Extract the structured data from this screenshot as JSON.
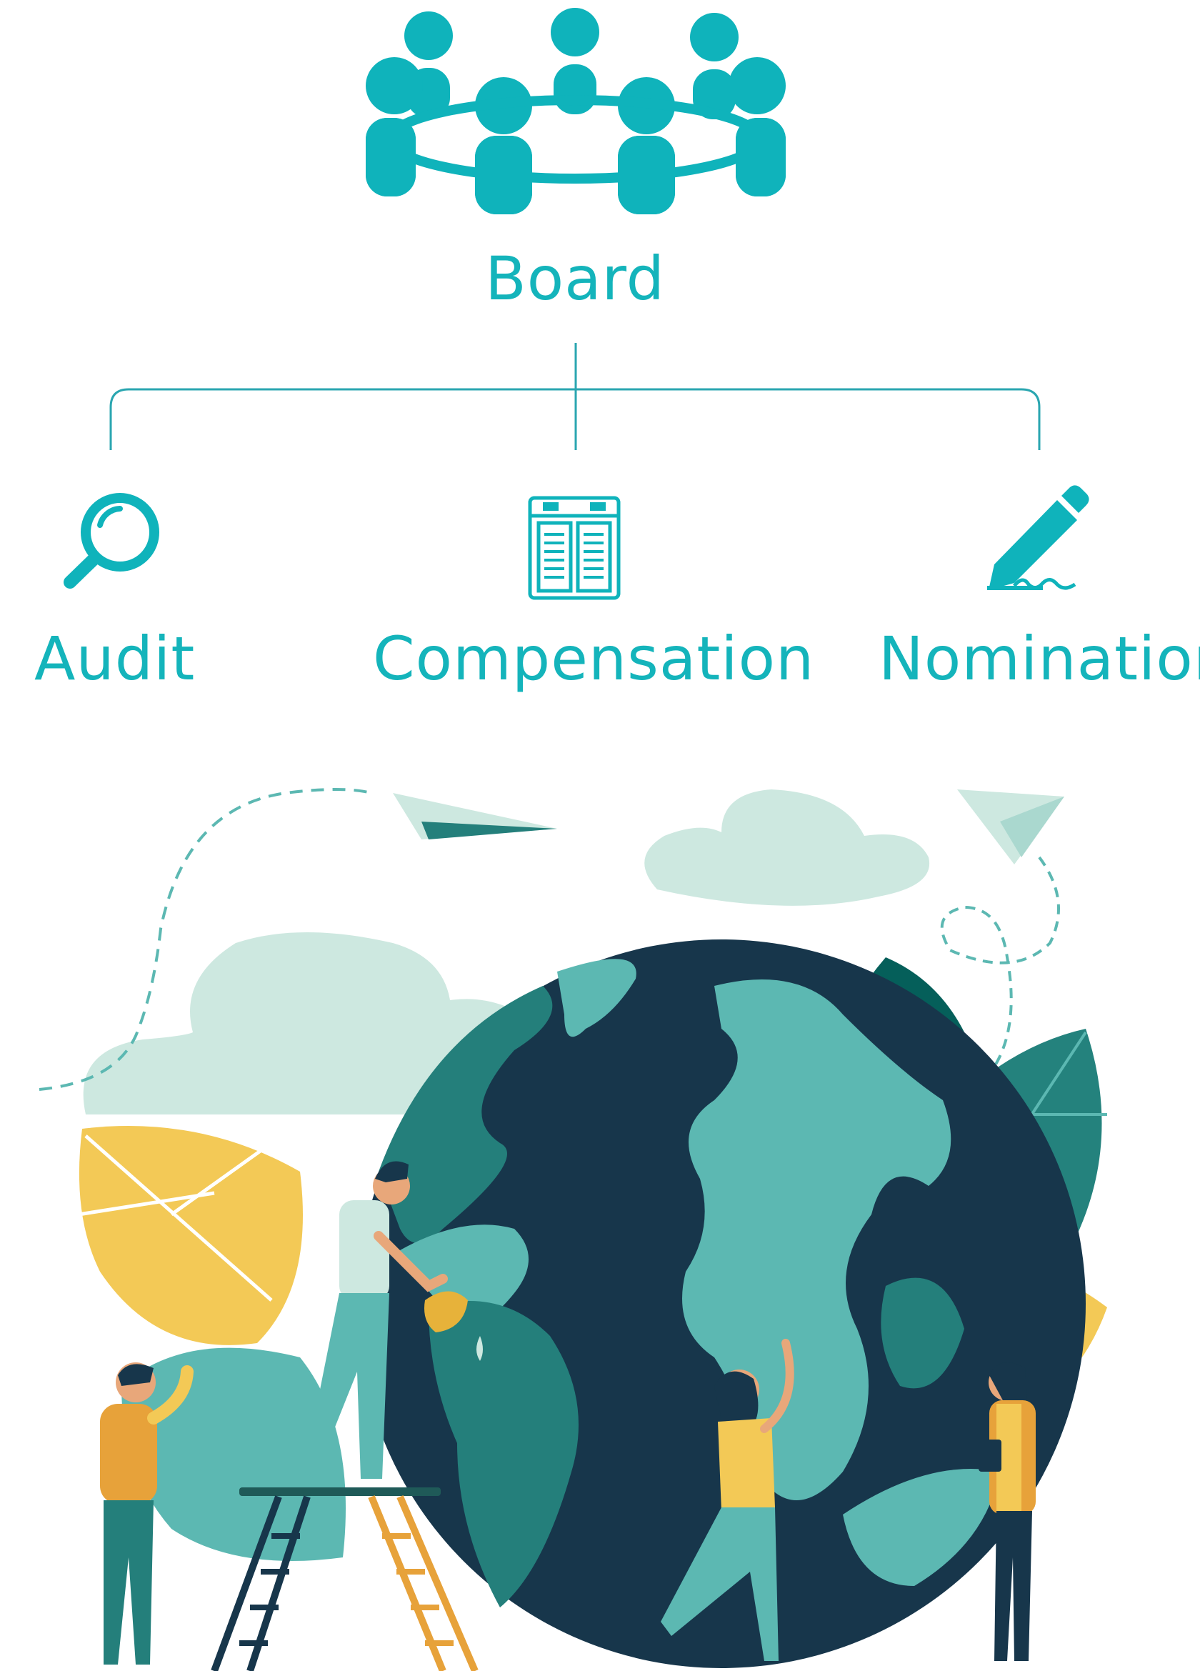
{
  "colors": {
    "accent": "#14b4bb",
    "line": "#2aa6b0",
    "globe_ocean": "#17364b",
    "globe_land_light": "#5cb8b2",
    "globe_land_dark": "#247f7b",
    "leaf_yellow": "#f3c956",
    "leaf_teal": "#24827d",
    "cloud": "#cde8e0"
  },
  "board": {
    "label": "Board",
    "icon": "board-meeting-icon"
  },
  "committees": [
    {
      "label": "Audit",
      "icon": "magnifier-icon"
    },
    {
      "label": "Compensation",
      "icon": "document-icon"
    },
    {
      "label": "Nomination",
      "icon": "pen-signature-icon"
    }
  ],
  "illustration": {
    "subject": "people caring for globe"
  }
}
